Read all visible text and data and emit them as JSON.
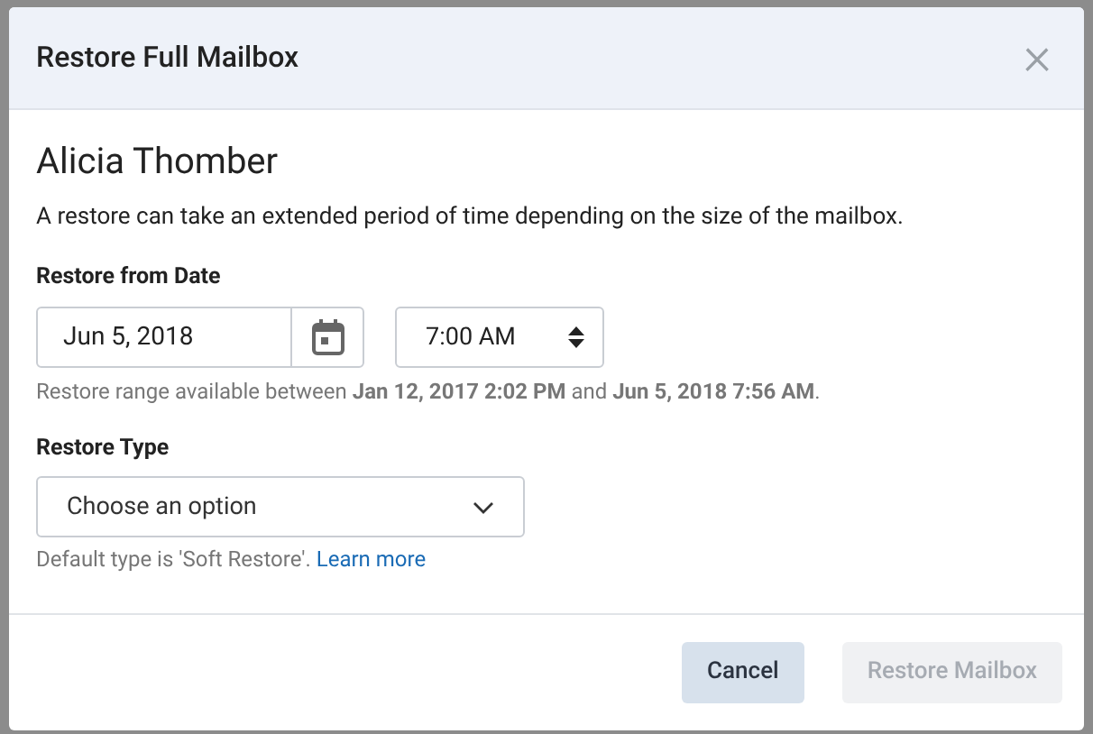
{
  "dialog": {
    "title": "Restore Full Mailbox",
    "close_icon": "×"
  },
  "user_name": "Alicia Thomber",
  "description": "A restore can take an extended period of time depending on the size of the mailbox.",
  "restore_from_date": {
    "label": "Restore from Date",
    "date": "Jun 5, 2018",
    "time": "7:00 AM",
    "hint": "Restore range available between **Jan 12, 2017 2:02 PM** and **Jun 5, 2018 7:56 AM**."
  },
  "restore_type": {
    "label": "Restore Type",
    "placeholder": "Choose an option",
    "hint": "Default type is 'Soft Restore'.",
    "link": "Learn more"
  },
  "buttons": [
    {
      "label": "Cancel",
      "disabled": false
    },
    {
      "label": "Restore Mailbox",
      "disabled": true
    }
  ]
}
